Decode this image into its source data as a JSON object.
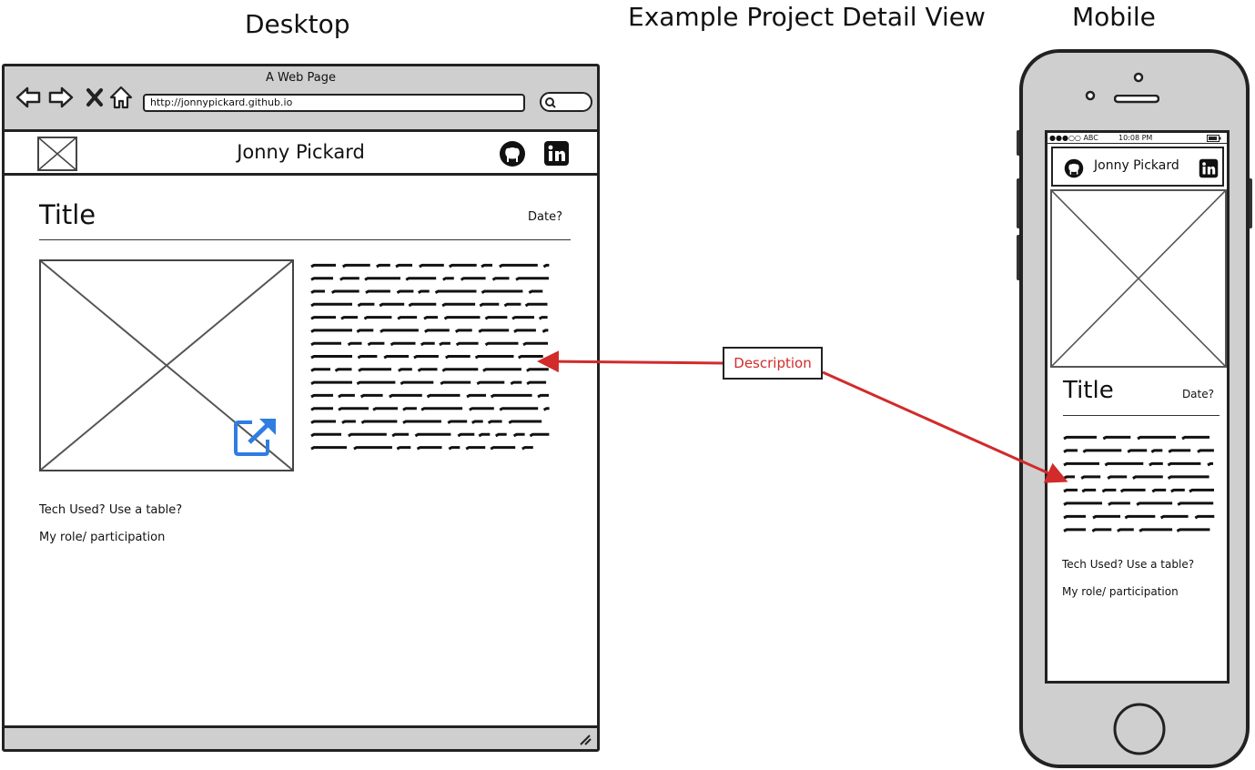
{
  "headings": {
    "desktop": "Desktop",
    "center": "Example Project Detail View",
    "mobile": "Mobile"
  },
  "desktop": {
    "window_title": "A Web Page",
    "url": "http://jonnypickard.github.io",
    "site_name": "Jonny Pickard",
    "project_title": "Title",
    "date": "Date?",
    "tech_used": "Tech Used? Use a table?",
    "role": "My role/ participation",
    "icons": [
      "back-icon",
      "forward-icon",
      "stop-icon",
      "home-icon",
      "search-icon",
      "image-placeholder-icon",
      "github-icon",
      "linkedin-icon",
      "external-link-icon",
      "resize-grip-icon"
    ]
  },
  "mobile": {
    "carrier": "●●●○○ ABC",
    "time": "10:08 PM",
    "site_name": "Jonny Pickard",
    "project_title": "Title",
    "date": "Date?",
    "tech_used": "Tech Used? Use a table?",
    "role": "My role/ participation",
    "icons": [
      "github-icon",
      "linkedin-icon",
      "image-placeholder-icon",
      "battery-icon"
    ]
  },
  "annotation": {
    "label": "Description",
    "color": "#d12b2b"
  },
  "colors": {
    "chrome": "#cfcfcf",
    "link_icon": "#2f7de1",
    "annotation": "#d12b2b"
  }
}
